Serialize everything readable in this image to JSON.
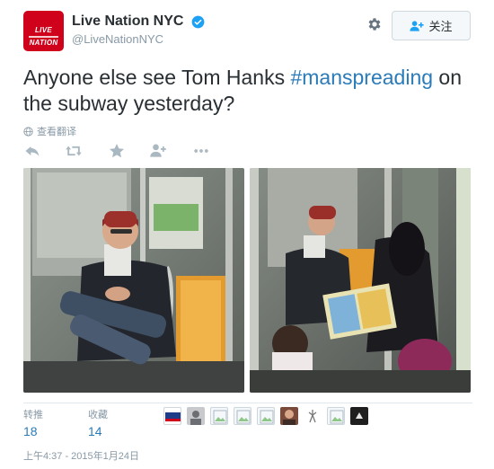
{
  "account": {
    "display_name": "Live Nation NYC",
    "handle": "@LiveNationNYC",
    "avatar_logo": "LIVE NATION",
    "verified_icon": "verified-badge-icon"
  },
  "header": {
    "follow_label": "关注",
    "settings_icon": "gear-icon",
    "follow_icon": "add-user-icon"
  },
  "tweet": {
    "text_before": "Anyone else see Tom Hanks ",
    "hashtag": "#manspreading",
    "text_after": " on the subway yesterday?",
    "translate_label": "查看翻译"
  },
  "actions": [
    "reply-icon",
    "retweet-icon",
    "favorite-icon",
    "follow-icon",
    "more-icon"
  ],
  "stats": {
    "retweets_label": "转推",
    "retweets_count": "18",
    "favorites_label": "收藏",
    "favorites_count": "14"
  },
  "likers_count": 9,
  "timestamp": "上午4:37 - 2015年1月24日",
  "colors": {
    "brand_red": "#d0021b",
    "link_blue": "#2b7bb9",
    "muted": "#8899a6"
  }
}
